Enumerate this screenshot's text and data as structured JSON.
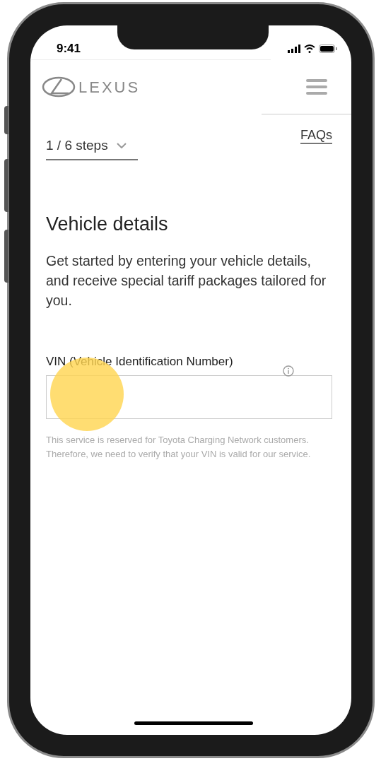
{
  "status_bar": {
    "time": "9:41"
  },
  "header": {
    "brand": "LEXUS"
  },
  "steps_dropdown": {
    "label": "1 / 6 steps",
    "expanded": false
  },
  "faq_link": {
    "label": "FAQs"
  },
  "heading": "Vehicle details",
  "description": "Get started by entering your vehicle details, and receive special tariff packages tailored for you.",
  "vin_field": {
    "label": "VIN (Vehicle Identification Number)"
  },
  "help_text": "This service is reserved for Toyota Charging Network customers. Therefore, we need to verify that your VIN is valid for our service."
}
